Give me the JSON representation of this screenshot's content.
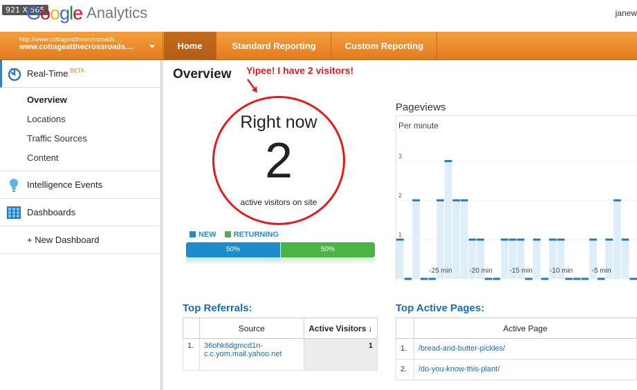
{
  "screenshot_badge": "921 X 565",
  "header": {
    "logo_google": [
      "G",
      "o",
      "o",
      "g",
      "l",
      "e"
    ],
    "logo_product": "Analytics",
    "user": "janew"
  },
  "nav": {
    "account_url": "http://www.cottageatthecrossroads....",
    "account_name": "www.cottageatthecrossroads....",
    "tabs": [
      "Home",
      "Standard Reporting",
      "Custom Reporting"
    ],
    "active_tab": "Home"
  },
  "sidebar": {
    "realtime": {
      "label": "Real-Time",
      "badge": "BETA"
    },
    "realtime_items": [
      "Overview",
      "Locations",
      "Traffic Sources",
      "Content"
    ],
    "active_item": "Overview",
    "intelligence": "Intelligence Events",
    "dashboards": "Dashboards",
    "new_dashboard": "+ New Dashboard"
  },
  "overview": {
    "title": "Overview",
    "annotation": "Yipee! I have 2 visitors!",
    "right_now_label": "Right now",
    "active_count": "2",
    "active_sub": "active visitors on site",
    "legend_new": "NEW",
    "legend_returning": "RETURNING",
    "new_pct": "50%",
    "returning_pct": "50%"
  },
  "pageviews": {
    "title": "Pageviews",
    "subtitle": "Per minute",
    "y_ticks": [
      "3",
      "2",
      "1"
    ],
    "x_ticks": [
      "-25 min",
      "-20 min",
      "-15 min",
      "-10 min",
      "-5 min"
    ]
  },
  "chart_data": {
    "type": "bar",
    "title": "Pageviews",
    "subtitle": "Per minute",
    "x": [
      -30,
      -29,
      -28,
      -27,
      -26,
      -25,
      -24,
      -23,
      -22,
      -21,
      -20,
      -19,
      -18,
      -17,
      -16,
      -15,
      -14,
      -13,
      -12,
      -11,
      -10,
      -9,
      -8,
      -7,
      -6,
      -5,
      -4,
      -3,
      -2,
      -1
    ],
    "values": [
      1,
      0,
      2,
      0,
      0,
      2,
      3,
      2,
      2,
      1,
      1,
      0,
      0,
      1,
      1,
      1,
      0,
      1,
      0,
      1,
      1,
      0,
      0,
      0,
      1,
      0,
      1,
      2,
      1,
      0
    ],
    "ylim": [
      0,
      3
    ],
    "y_ticks": [
      1,
      2,
      3
    ],
    "x_ticks": [
      "-25 min",
      "-20 min",
      "-15 min",
      "-10 min",
      "-5 min"
    ],
    "grid": true,
    "colors": {
      "fill": "#deeef8",
      "line": "#1d78c1"
    }
  },
  "referrals": {
    "title": "Top Referrals:",
    "col_source": "Source",
    "col_visitors": "Active Visitors",
    "rows": [
      {
        "n": "1.",
        "source": "36ohk6dgmcd1n-c.c.yom.mail.yahoo.net",
        "visitors": "1"
      }
    ]
  },
  "pages": {
    "title": "Top Active Pages:",
    "col_page": "Active Page",
    "rows": [
      {
        "n": "1.",
        "page": "/bread-and-butter-pickles/"
      },
      {
        "n": "2.",
        "page": "/do-you-know-this-plant/"
      }
    ]
  }
}
